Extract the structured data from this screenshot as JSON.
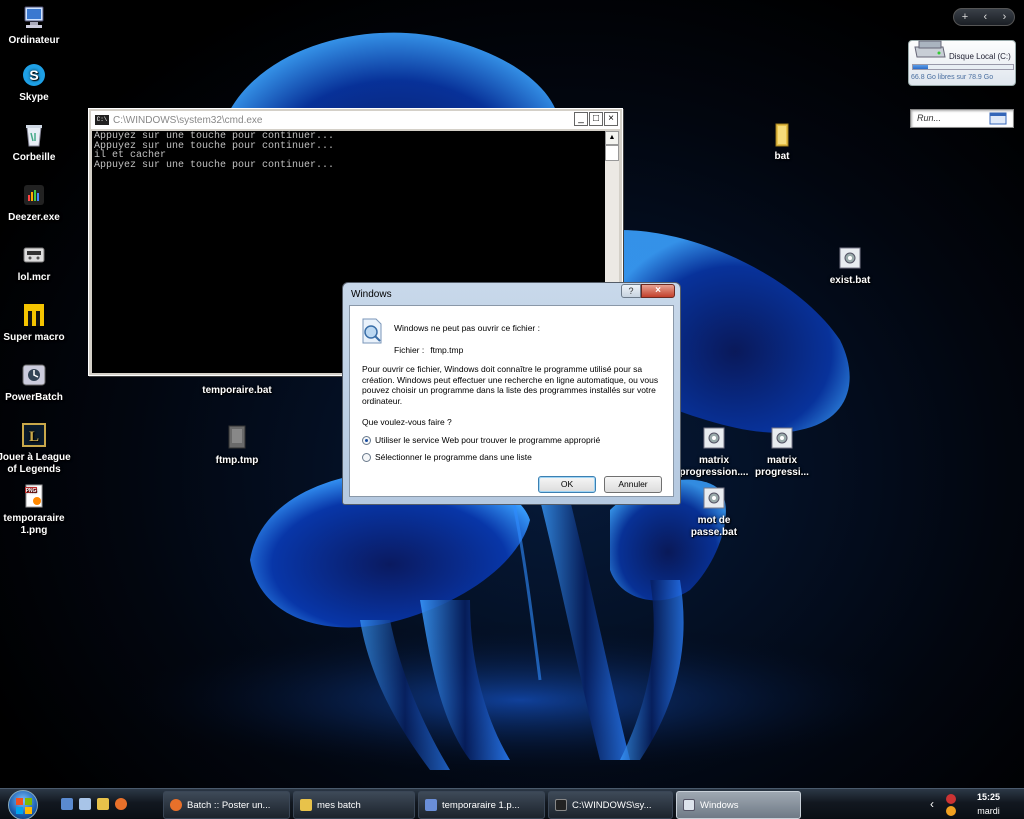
{
  "desktop": {
    "icons_left": [
      {
        "label": "Ordinateur",
        "icon": "computer-icon"
      },
      {
        "label": "Skype",
        "icon": "skype-icon"
      },
      {
        "label": "Corbeille",
        "icon": "recycle-bin-icon"
      },
      {
        "label": "Deezer.exe",
        "icon": "deezer-icon"
      },
      {
        "label": "lol.mcr",
        "icon": "macro-file-icon"
      },
      {
        "label": "Super macro",
        "icon": "super-macro-icon"
      },
      {
        "label": "PowerBatch",
        "icon": "powerbatch-icon"
      },
      {
        "label": "Jouer à League of Legends",
        "icon": "league-of-legends-icon"
      },
      {
        "label": "temporaraire 1.png",
        "icon": "png-file-icon"
      }
    ],
    "icon_temporaire_bat": "temporaire.bat",
    "icon_ftmp_tmp": "ftmp.tmp",
    "icon_bat_folder": "bat",
    "icon_exist_bat": "exist.bat",
    "icon_matrix1": "matrix progression....",
    "icon_matrix2": "matrix progressi...",
    "icon_mot_de_passe": "mot de passe.bat"
  },
  "gadgets": {
    "toolbar": {
      "add": "+",
      "prev": "‹",
      "next": "›"
    },
    "disk": {
      "title": "Disque Local (C:)",
      "info": "66.8 Go libres sur 78.9 Go",
      "used_fraction": 0.15
    },
    "run": {
      "label": "Run..."
    }
  },
  "cmd": {
    "title": "C:\\WINDOWS\\system32\\cmd.exe",
    "icon_text": "C:\\",
    "lines": [
      "Appuyez sur une touche pour continuer...",
      "Appuyez sur une touche pour continuer...",
      "il et cacher",
      "Appuyez sur une touche pour continuer..."
    ],
    "btn_min": "_",
    "btn_max": "□",
    "btn_close": "×"
  },
  "dialog": {
    "title": "Windows",
    "help": "?",
    "close": "×",
    "heading": "Windows ne peut pas ouvrir ce fichier :",
    "file_label": "Fichier :",
    "file_value": "ftmp.tmp",
    "description": "Pour ouvrir ce fichier, Windows doit connaître le programme utilisé pour sa création. Windows peut effectuer une recherche en ligne automatique, ou vous pouvez choisir un programme dans la liste des programmes installés sur votre ordinateur.",
    "question": "Que voulez-vous faire ?",
    "options": [
      {
        "label": "Utiliser le service Web pour trouver le programme approprié",
        "selected": true
      },
      {
        "label": "Sélectionner le programme dans une liste",
        "selected": false
      }
    ],
    "ok": "OK",
    "cancel": "Annuler"
  },
  "taskbar": {
    "tasks": [
      {
        "label": "Batch :: Poster un...",
        "icon": "firefox-icon",
        "color": "#e8702a"
      },
      {
        "label": "mes batch",
        "icon": "folder-icon",
        "color": "#e8c24a"
      },
      {
        "label": "temporaraire 1.p...",
        "icon": "paint-icon",
        "color": "#6a8ed8"
      },
      {
        "label": "C:\\WINDOWS\\sy...",
        "icon": "cmd-icon",
        "color": "#222222"
      },
      {
        "label": "Windows",
        "icon": "window-icon",
        "color": "#dde4ec"
      }
    ],
    "tray_arrow": "‹",
    "time": "15:25",
    "day": "mardi"
  }
}
